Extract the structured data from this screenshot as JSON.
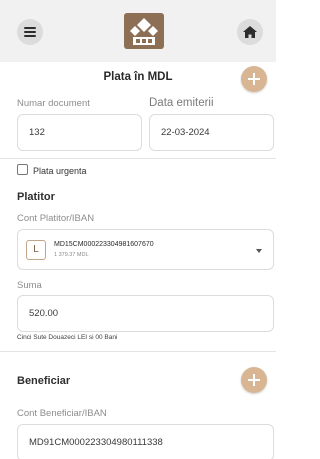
{
  "header": {
    "menu_icon": "hamburger-menu-icon",
    "logo_icon": "bank-logo-icon",
    "home_icon": "home-icon"
  },
  "page": {
    "title": "Plata în MDL",
    "add_icon": "plus-icon"
  },
  "document": {
    "number_label": "Numar document",
    "number_value": "132",
    "date_label": "Data emiterii",
    "date_value": "22-03-2024"
  },
  "urgent": {
    "label": "Plata urgenta",
    "checked": false
  },
  "payer": {
    "section_title": "Platitor",
    "account_label": "Cont Platitor/IBAN",
    "account_badge": "L",
    "account_number": "MD15CM000223304981607670",
    "account_balance": "1 379.37 MDL",
    "dropdown_icon": "caret-down-icon"
  },
  "amount": {
    "label": "Suma",
    "value": "520.00",
    "in_words": "Cinci Sute Douazeci LEI si 00 Bani"
  },
  "beneficiary": {
    "section_title": "Beneficiar",
    "account_label": "Cont Beneficiar/IBAN",
    "account_value": "MD91CM000223304980111338"
  },
  "colors": {
    "accent": "#d9b693",
    "brand": "#8d6f55",
    "header_bg": "#f1f1f1"
  }
}
